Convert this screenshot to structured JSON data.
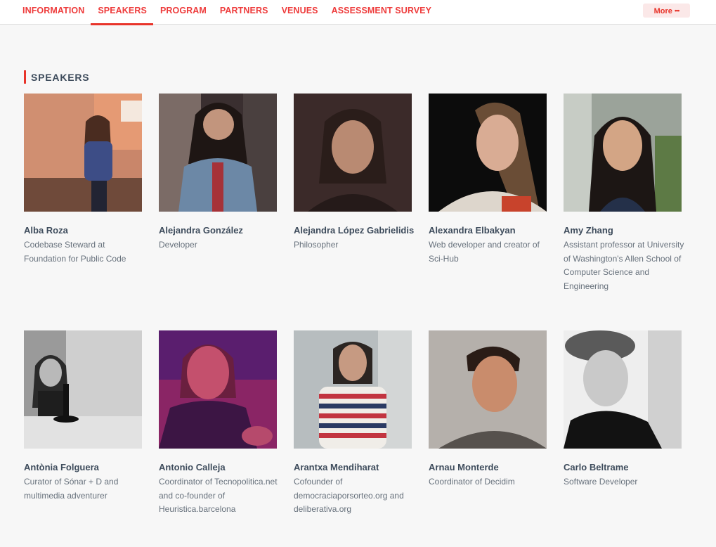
{
  "nav": {
    "tabs": [
      {
        "label": "INFORMATION"
      },
      {
        "label": "SPEAKERS",
        "active": true
      },
      {
        "label": "PROGRAM"
      },
      {
        "label": "PARTNERS"
      },
      {
        "label": "VENUES"
      },
      {
        "label": "ASSESSMENT SURVEY"
      }
    ],
    "more_label": "More",
    "more_icon": "•••"
  },
  "section": {
    "title": "SPEAKERS"
  },
  "speakers": [
    {
      "name": "Alba Roza",
      "role": "Codebase Steward at Foundation for Public Code"
    },
    {
      "name": "Alejandra González",
      "role": "Developer"
    },
    {
      "name": "Alejandra López Gabrielidis",
      "role": "Philosopher"
    },
    {
      "name": "Alexandra Elbakyan",
      "role": "Web developer and creator of Sci-Hub"
    },
    {
      "name": "Amy Zhang",
      "role": "Assistant professor at University of Washington's Allen School of Computer Science and Engineering"
    },
    {
      "name": "Antònia Folguera",
      "role": "Curator of Sónar + D and multimedia adventurer"
    },
    {
      "name": "Antonio Calleja",
      "role": "Coordinator of Tecnopolitica.net and co-founder of Heuristica.barcelona"
    },
    {
      "name": "Arantxa Mendiharat",
      "role": "Cofounder of democraciaporsorteo.org and deliberativa.org"
    },
    {
      "name": "Arnau Monterde",
      "role": "Coordinator of Decidim"
    },
    {
      "name": "Carlo Beltrame",
      "role": "Software Developer"
    }
  ],
  "colors": {
    "accent": "#e8342a",
    "text": "#3e4c5c",
    "muted": "#67717c",
    "background": "#f7f7f7"
  }
}
